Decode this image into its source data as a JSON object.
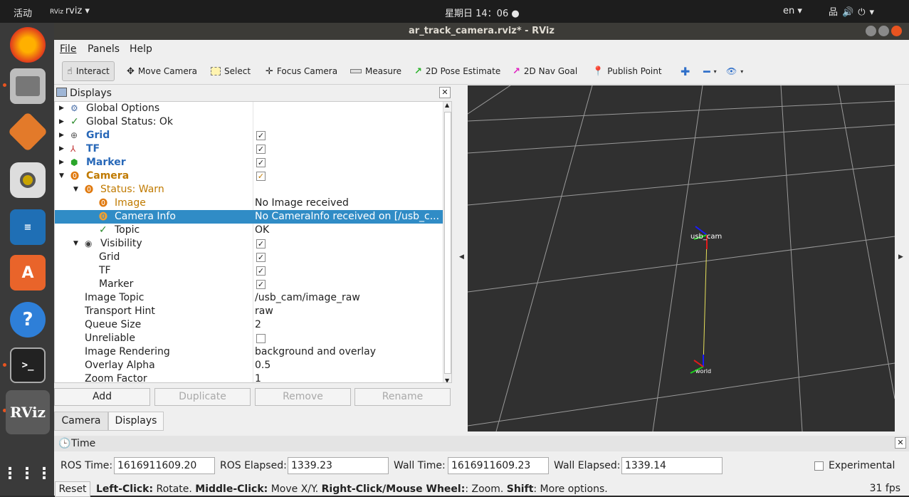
{
  "topbar": {
    "activities": "活动",
    "app": "rviz",
    "clock": "星期日 14：06",
    "lang": "en"
  },
  "window": {
    "title": "ar_track_camera.rviz* - RViz"
  },
  "menu": [
    "File",
    "Panels",
    "Help"
  ],
  "toolbar": [
    {
      "label": "Interact",
      "icon": "hand-icon"
    },
    {
      "label": "Move Camera",
      "icon": "move-icon"
    },
    {
      "label": "Select",
      "icon": "select-icon"
    },
    {
      "label": "Focus Camera",
      "icon": "focus-icon"
    },
    {
      "label": "Measure",
      "icon": "ruler-icon"
    },
    {
      "label": "2D Pose Estimate",
      "icon": "green-arrow-icon"
    },
    {
      "label": "2D Nav Goal",
      "icon": "pink-arrow-icon"
    },
    {
      "label": "Publish Point",
      "icon": "pin-icon"
    }
  ],
  "displays": {
    "title": "Displays",
    "rows": [
      {
        "name": "Global Options",
        "value": ""
      },
      {
        "name": "Global Status: Ok",
        "value": ""
      },
      {
        "name": "Grid",
        "value": "✓"
      },
      {
        "name": "TF",
        "value": "✓"
      },
      {
        "name": "Marker",
        "value": "✓"
      },
      {
        "name": "Camera",
        "value": "✓"
      },
      {
        "name": "Status: Warn",
        "value": ""
      },
      {
        "name": "Image",
        "value": "No Image received"
      },
      {
        "name": "Camera Info",
        "value": "No CameraInfo received on [/usb_c..."
      },
      {
        "name": "Topic",
        "value": "OK"
      },
      {
        "name": "Visibility",
        "value": "✓"
      },
      {
        "name": "Grid",
        "value": "✓"
      },
      {
        "name": "TF",
        "value": "✓"
      },
      {
        "name": "Marker",
        "value": "✓"
      },
      {
        "name": "Image Topic",
        "value": "/usb_cam/image_raw"
      },
      {
        "name": "Transport Hint",
        "value": "raw"
      },
      {
        "name": "Queue Size",
        "value": "2"
      },
      {
        "name": "Unreliable",
        "value": ""
      },
      {
        "name": "Image Rendering",
        "value": "background and overlay"
      },
      {
        "name": "Overlay Alpha",
        "value": "0.5"
      },
      {
        "name": "Zoom Factor",
        "value": "1"
      }
    ],
    "buttons": [
      "Add",
      "Duplicate",
      "Remove",
      "Rename"
    ],
    "tabs": [
      "Camera",
      "Displays"
    ]
  },
  "view": {
    "frame1": "usb_cam",
    "frame2": "world"
  },
  "time": {
    "title": "Time",
    "ros_time_label": "ROS Time:",
    "ros_time": "1616911609.20",
    "ros_elapsed_label": "ROS Elapsed:",
    "ros_elapsed": "1339.23",
    "wall_time_label": "Wall Time:",
    "wall_time": "1616911609.23",
    "wall_elapsed_label": "Wall Elapsed:",
    "wall_elapsed": "1339.14",
    "experimental": "Experimental"
  },
  "status": {
    "reset": "Reset",
    "k1": "Left-Click:",
    "v1": " Rotate. ",
    "k2": "Middle-Click:",
    "v2": " Move X/Y. ",
    "k3": "Right-Click/Mouse Wheel:",
    "v3": ": Zoom. ",
    "k4": "Shift",
    "v4": ": More options.",
    "fps": "31 fps"
  }
}
